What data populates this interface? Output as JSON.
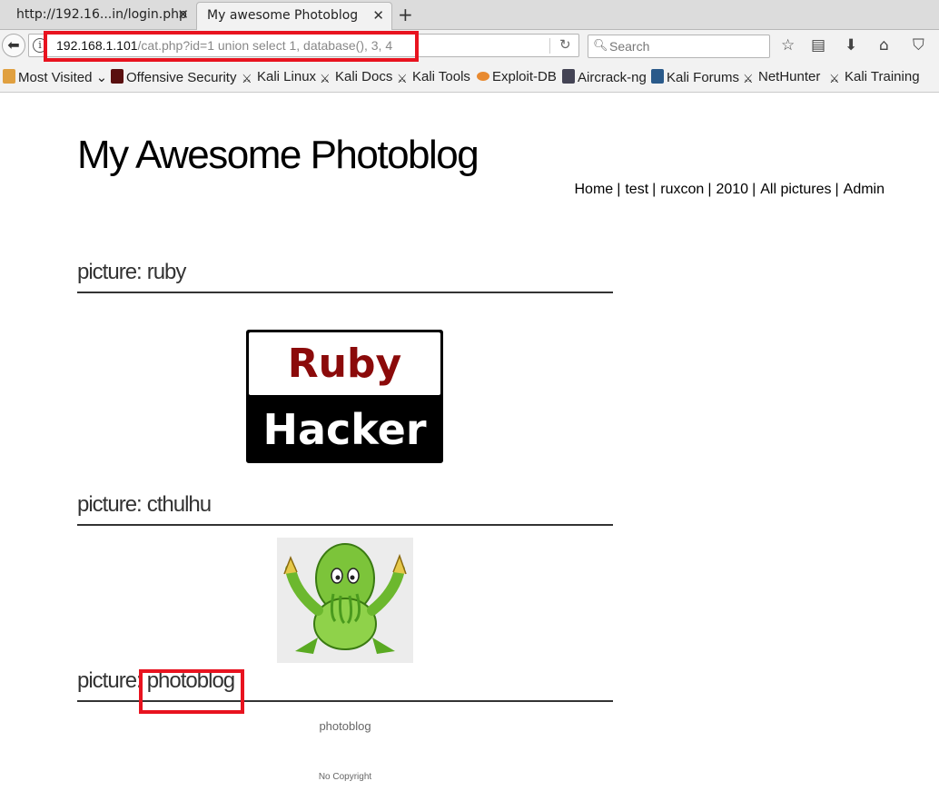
{
  "browser": {
    "tabs": [
      {
        "title": "http://192.16...in/login.php",
        "active": false
      },
      {
        "title": "My awesome Photoblog",
        "active": true
      }
    ],
    "url": {
      "host": "192.168.1.101",
      "path": "/cat.php?id=1 union select 1, database(), 3, 4"
    },
    "search_placeholder": "Search",
    "bookmarks": [
      "Most Visited",
      "Offensive Security",
      "Kali Linux",
      "Kali Docs",
      "Kali Tools",
      "Exploit-DB",
      "Aircrack-ng",
      "Kali Forums",
      "NetHunter",
      "Kali Training"
    ],
    "highlight_color": "#e8131f"
  },
  "page": {
    "site_title": "My Awesome Photoblog",
    "menu": [
      "Home",
      "test",
      "ruxcon",
      "2010",
      "All pictures",
      "Admin"
    ],
    "menu_separator": "|",
    "picture_prefix": "picture:",
    "pictures": [
      {
        "name": "ruby",
        "image_text_top": "Ruby",
        "image_text_bottom": "Hacker"
      },
      {
        "name": "cthulhu"
      },
      {
        "name": "photoblog",
        "caption": "photoblog"
      }
    ],
    "footer": "No Copyright"
  }
}
